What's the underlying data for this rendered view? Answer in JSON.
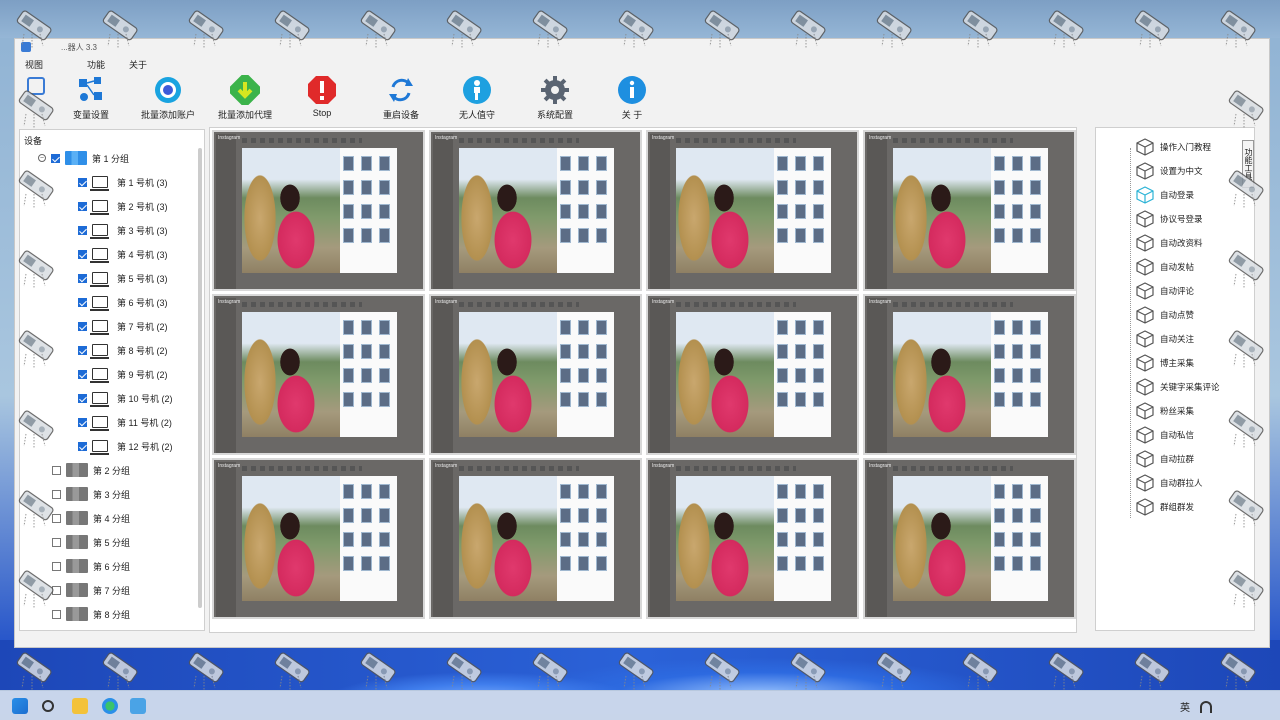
{
  "window": {
    "title": "...器人 3.3"
  },
  "menu": {
    "view": "视图",
    "function": "功能",
    "about": "关于"
  },
  "toolbar": [
    {
      "label": "变量设置",
      "icon": "variables-icon"
    },
    {
      "label": "批量添加账户",
      "icon": "add-account-icon"
    },
    {
      "label": "批量添加代理",
      "icon": "add-proxy-icon"
    },
    {
      "label": "Stop",
      "icon": "stop-icon"
    },
    {
      "label": "重启设备",
      "icon": "restart-icon"
    },
    {
      "label": "无人值守",
      "icon": "unattended-icon"
    },
    {
      "label": "系统配置",
      "icon": "gear-icon"
    },
    {
      "label": "关 于",
      "icon": "info-icon"
    }
  ],
  "left": {
    "header": "设备",
    "group1": "第 1 分组",
    "devices": [
      {
        "label": "第 1 号机  (3)"
      },
      {
        "label": "第 2 号机  (3)"
      },
      {
        "label": "第 3 号机  (3)"
      },
      {
        "label": "第 4 号机  (3)"
      },
      {
        "label": "第 5 号机  (3)"
      },
      {
        "label": "第 6 号机  (3)"
      },
      {
        "label": "第 7 号机  (2)"
      },
      {
        "label": "第 8 号机  (2)"
      },
      {
        "label": "第 9 号机  (2)"
      },
      {
        "label": "第 10 号机  (2)"
      },
      {
        "label": "第 11 号机  (2)"
      },
      {
        "label": "第 12 号机  (2)"
      }
    ],
    "groups": [
      "第 2 分组",
      "第 3 分组",
      "第 4 分组",
      "第 5 分组",
      "第 6 分组",
      "第 7 分组",
      "第 8 分组"
    ]
  },
  "screens": {
    "app_name": "Instagram"
  },
  "right": {
    "tab": "功能工具",
    "items": [
      "操作入门教程",
      "设置为中文",
      "自动登录",
      "协议号登录",
      "自动改资料",
      "自动发帖",
      "自动评论",
      "自动点赞",
      "自动关注",
      "博主采集",
      "关键字采集评论",
      "粉丝采集",
      "自动私信",
      "自动拉群",
      "自动群拉人",
      "群组群发"
    ]
  },
  "taskbar": {
    "ime": "英"
  }
}
